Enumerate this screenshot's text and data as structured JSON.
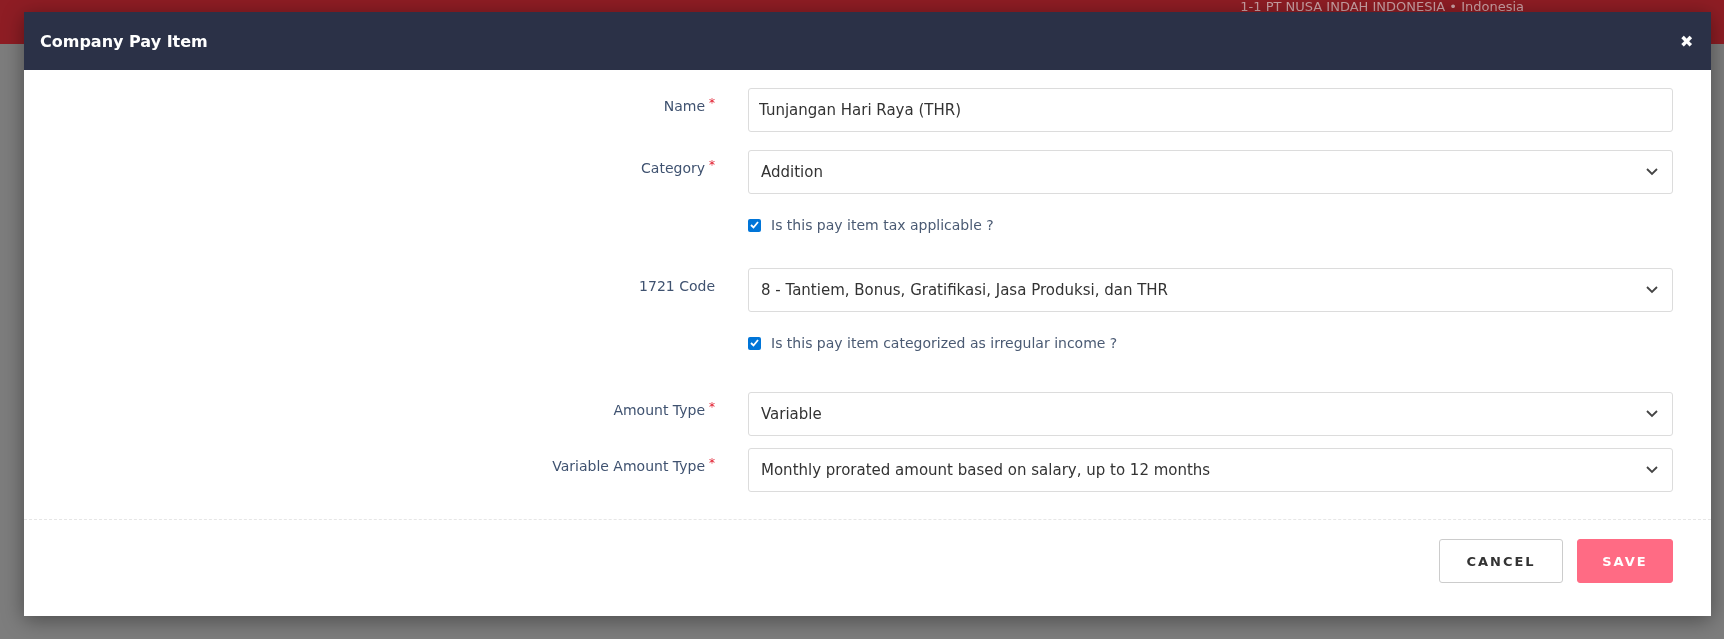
{
  "background": {
    "company": "1-1 PT NUSA INDAH INDONESIA • Indonesia"
  },
  "dialog": {
    "title": "Company Pay Item",
    "close": "✖",
    "fields": [
      {
        "kind": "text",
        "label": "Name",
        "required_mark": "*",
        "value": "Tunjangan Hari Raya (THR)"
      },
      {
        "kind": "select",
        "label": "Category",
        "required_mark": "*",
        "value": "Addition"
      },
      {
        "kind": "checkbox",
        "label": "Is this pay item tax applicable ?",
        "checked": true
      },
      {
        "kind": "select",
        "label": "1721 Code",
        "value": "8 - Tantiem, Bonus, Gratifikasi, Jasa Produksi, dan THR"
      },
      {
        "kind": "checkbox",
        "label": "Is this pay item categorized as irregular income ?",
        "checked": true
      },
      {
        "kind": "select",
        "label": "Amount Type",
        "required_mark": "*",
        "value": "Variable"
      },
      {
        "kind": "select",
        "label": "Variable Amount Type",
        "required_mark": "*",
        "value": "Monthly prorated amount based on salary, up to 12 months"
      }
    ],
    "buttons": [
      {
        "label": "CANCEL",
        "kind": "secondary"
      },
      {
        "label": "SAVE",
        "kind": "primary"
      }
    ]
  }
}
